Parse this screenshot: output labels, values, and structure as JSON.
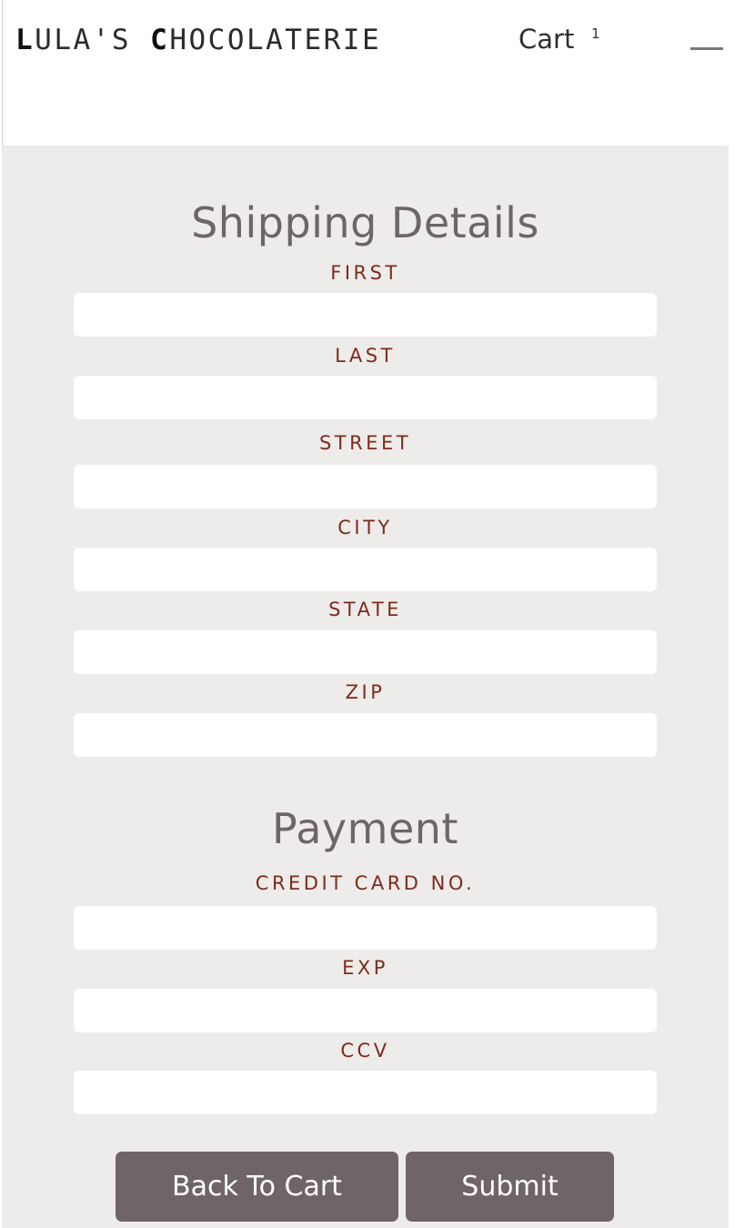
{
  "header": {
    "brand_first_initial": "L",
    "brand_first_rest": "ULA'S ",
    "brand_second_initial": "C",
    "brand_second_rest": "HOCOLATERIE",
    "cart_label": "Cart",
    "cart_count": "1",
    "menu_icon": "hamburger-menu-icon"
  },
  "shipping": {
    "title": "Shipping Details",
    "fields": [
      {
        "label": "FIRST",
        "value": ""
      },
      {
        "label": "LAST",
        "value": ""
      },
      {
        "label": "STREET",
        "value": ""
      },
      {
        "label": "CITY",
        "value": ""
      },
      {
        "label": "STATE",
        "value": ""
      },
      {
        "label": "ZIP",
        "value": ""
      }
    ]
  },
  "payment": {
    "title": "Payment",
    "fields": [
      {
        "label": "CREDIT CARD NO.",
        "value": ""
      },
      {
        "label": "EXP",
        "value": ""
      },
      {
        "label": "CCV",
        "value": ""
      }
    ]
  },
  "actions": {
    "back_label": "Back To Cart",
    "submit_label": "Submit"
  },
  "colors": {
    "panel_background": "#eeecea",
    "label_color": "#7d2b1b",
    "title_color": "#6e6666",
    "button_background": "#706566",
    "button_text": "#ffffff"
  }
}
